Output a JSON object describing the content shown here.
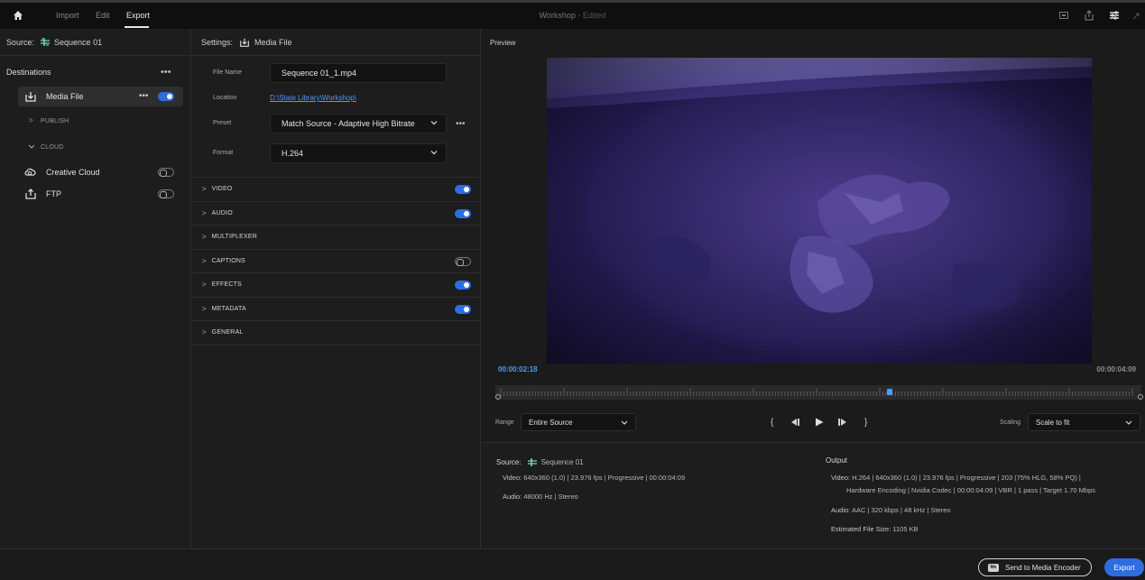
{
  "topbar": {
    "nav": [
      "Import",
      "Edit",
      "Export"
    ],
    "active_tab": "Export",
    "project_title": "Workshop",
    "edited_suffix": "- Edited"
  },
  "source_panel": {
    "label": "Source:",
    "sequence": "Sequence 01"
  },
  "destinations": {
    "title": "Destinations",
    "media_file": {
      "label": "Media File",
      "enabled": true
    },
    "publish_label": "PUBLISH",
    "cloud_label": "CLOUD",
    "creative_cloud": {
      "label": "Creative Cloud",
      "enabled": false
    },
    "ftp": {
      "label": "FTP",
      "enabled": false
    }
  },
  "settings": {
    "header_label": "Settings:",
    "header_target": "Media File",
    "file_name_label": "File Name",
    "file_name": "Sequence 01_1.mp4",
    "location_label": "Location",
    "location": "D:\\State Library\\Workshop\\",
    "preset_label": "Preset",
    "preset": "Match Source - Adaptive High Bitrate",
    "format_label": "Format",
    "format": "H.264",
    "sections": [
      {
        "name": "VIDEO",
        "toggle": "on"
      },
      {
        "name": "AUDIO",
        "toggle": "on"
      },
      {
        "name": "MULTIPLEXER",
        "toggle": "none"
      },
      {
        "name": "CAPTIONS",
        "toggle": "off"
      },
      {
        "name": "EFFECTS",
        "toggle": "on"
      },
      {
        "name": "METADATA",
        "toggle": "on"
      },
      {
        "name": "GENERAL",
        "toggle": "none"
      }
    ]
  },
  "preview": {
    "title": "Preview",
    "current_timecode": "00:00:02:18",
    "duration_timecode": "00:00:04:09",
    "playhead_fraction": 0.61,
    "range_label": "Range",
    "range_value": "Entire Source",
    "scaling_label": "Scaling",
    "scaling_value": "Scale to fit",
    "controls": [
      "{",
      "◀▍",
      "▶",
      "▍▶",
      "}"
    ]
  },
  "source_info": {
    "title": "Source:",
    "sequence": "Sequence 01",
    "video_label": "Video:",
    "video": "640x360 (1.0)  |  23.976 fps  |  Progressive  |  00:00:04:09",
    "audio_label": "Audio:",
    "audio": "48000 Hz  |  Stereo"
  },
  "output_info": {
    "title": "Output",
    "video_label": "Video:",
    "video_line1": "H.264  |  640x360 (1.0)  |  23.976 fps  |  Progressive  |  203 (75% HLG, 58% PQ)  |",
    "video_line2": "Hardware Encoding  |  Nvidia Codec  |  00:00:04:09   |  VBR  |  1 pass  |  Target 1.70 Mbps",
    "audio_label": "Audio:",
    "audio": "AAC  |  320 kbps  |  48 kHz  |  Stereo",
    "size_label": "Estimated File Size:",
    "size": "1105 KB"
  },
  "footer": {
    "send_label": "Send to Media Encoder",
    "send_badge": "Me",
    "export_label": "Export"
  },
  "colors": {
    "accent": "#2c6de0",
    "link": "#4b9cf5"
  }
}
